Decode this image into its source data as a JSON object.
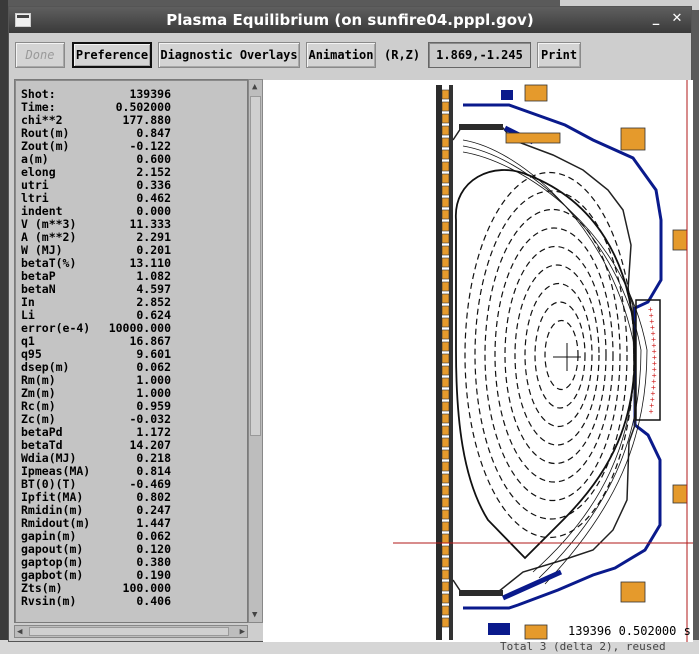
{
  "window": {
    "title": "Plasma Equilibrium (on sunfire04.pppl.gov)",
    "minimize_glyph": "_",
    "close_glyph": "✕"
  },
  "toolbar": {
    "done_label": "Done",
    "preference_label": "Preference",
    "diagnostic_label": "Diagnostic Overlays",
    "animation_label": "Animation",
    "rz_label": "(R,Z)",
    "coord_value": "1.869,-1.245",
    "print_label": "Print"
  },
  "params": [
    {
      "key": "Shot:",
      "value": "139396"
    },
    {
      "key": "Time:",
      "value": "0.502000"
    },
    {
      "key": "chi**2",
      "value": "177.880"
    },
    {
      "key": "Rout(m)",
      "value": "0.847"
    },
    {
      "key": "Zout(m)",
      "value": "-0.122"
    },
    {
      "key": "a(m)",
      "value": "0.600"
    },
    {
      "key": "elong",
      "value": "2.152"
    },
    {
      "key": "utri",
      "value": "0.336"
    },
    {
      "key": "ltri",
      "value": "0.462"
    },
    {
      "key": "indent",
      "value": "0.000"
    },
    {
      "key": "V (m**3)",
      "value": "11.333"
    },
    {
      "key": "A (m**2)",
      "value": "2.291"
    },
    {
      "key": "W (MJ)",
      "value": "0.201"
    },
    {
      "key": "betaT(%)",
      "value": "13.110"
    },
    {
      "key": "betaP",
      "value": "1.082"
    },
    {
      "key": "betaN",
      "value": "4.597"
    },
    {
      "key": "In",
      "value": "2.852"
    },
    {
      "key": "Li",
      "value": "0.624"
    },
    {
      "key": "error(e-4)",
      "value": "10000.000"
    },
    {
      "key": "q1",
      "value": "16.867"
    },
    {
      "key": "q95",
      "value": "9.601"
    },
    {
      "key": "dsep(m)",
      "value": "0.062"
    },
    {
      "key": "Rm(m)",
      "value": "1.000"
    },
    {
      "key": "Zm(m)",
      "value": "1.000"
    },
    {
      "key": "Rc(m)",
      "value": "0.959"
    },
    {
      "key": "Zc(m)",
      "value": "-0.032"
    },
    {
      "key": "betaPd",
      "value": "1.172"
    },
    {
      "key": "betaTd",
      "value": "14.207"
    },
    {
      "key": "Wdia(MJ)",
      "value": "0.218"
    },
    {
      "key": "Ipmeas(MA)",
      "value": "0.814"
    },
    {
      "key": "BT(0)(T)",
      "value": "-0.469"
    },
    {
      "key": "Ipfit(MA)",
      "value": "0.802"
    },
    {
      "key": "Rmidin(m)",
      "value": "0.247"
    },
    {
      "key": "Rmidout(m)",
      "value": "1.447"
    },
    {
      "key": "gapin(m)",
      "value": "0.062"
    },
    {
      "key": "gapout(m)",
      "value": "0.120"
    },
    {
      "key": "gaptop(m)",
      "value": "0.380"
    },
    {
      "key": "gapbot(m)",
      "value": "0.190"
    },
    {
      "key": "Zts(m)",
      "value": "100.000"
    },
    {
      "key": "Rvsin(m)",
      "value": "0.406"
    }
  ],
  "plot": {
    "status_text": "139396 0.502000 s"
  },
  "background": {
    "bottom_text": "Total 3 (delta 2), reused"
  },
  "colors": {
    "vessel": "#0a1a8c",
    "crosshair": "#b01818",
    "coil": "#e59a2c",
    "probe_marks": "#d02020"
  }
}
